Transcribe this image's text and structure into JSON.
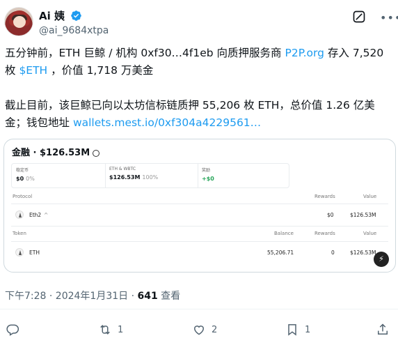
{
  "author": {
    "name": "Ai 姨",
    "handle": "@ai_9684xtpa"
  },
  "tweet": {
    "para1": {
      "text_a": "五分钟前，ETH 巨鲸 / 机构 0xf30…4f1eb 向质押服务商 ",
      "link_platform": "P2P.org",
      "text_b": " 存入 7,520 枚 ",
      "cashtag": "$ETH",
      "text_c": " ，价值 1,718 万美金"
    },
    "para2": {
      "text_a": "截止目前，该巨鲸已向以太坊信标链质押 55,206 枚 ETH，总价值 1.26 亿美金；钱包地址 ",
      "wallet_link": "wallets.mest.io/0xf304a4229561…"
    }
  },
  "card": {
    "title": "金融 · $126.53M",
    "stats": [
      {
        "label": "稳定币",
        "value": "$0",
        "sub": "0%"
      },
      {
        "label": "ETH & WBTC",
        "value": "$126.53M",
        "sub": "100%"
      },
      {
        "label": "奖励",
        "value": "+$0",
        "sub": ""
      }
    ],
    "protocol_header": {
      "protocol": "Protocol",
      "rewards": "Rewards",
      "value": "Value"
    },
    "protocol_row": {
      "name": "Eth2",
      "toggle": "^",
      "rewards": "$0",
      "value": "$126.53M"
    },
    "token_header": {
      "token": "Token",
      "balance": "Balance",
      "rewards": "Rewards",
      "value": "Value"
    },
    "token_row": {
      "name": "ETH",
      "balance": "55,206.71",
      "rewards": "0",
      "value": "$126.53M"
    }
  },
  "meta": {
    "timestamp": "下午7:28 · 2024年1月31日 · ",
    "views": "641",
    "views_label": " 查看"
  },
  "actions": {
    "reply_count": "",
    "retweet_count": "1",
    "like_count": "2",
    "bookmark_count": "1"
  },
  "colors": {
    "link": "#1d9bf0",
    "verified": "#1d9bf0",
    "reward_green": "#27a55a",
    "secondary_text": "#536471"
  },
  "icons": [
    "verified-badge-icon",
    "grok-icon",
    "more-icon",
    "reply-icon",
    "retweet-icon",
    "like-icon",
    "bookmark-icon",
    "share-icon",
    "ethereum-icon",
    "lightning-icon"
  ]
}
